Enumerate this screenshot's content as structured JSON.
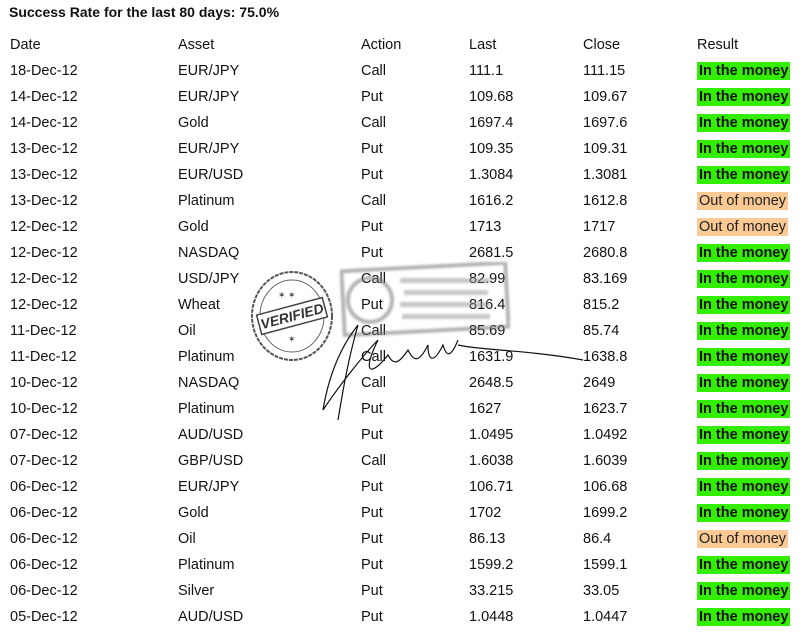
{
  "title": "Success Rate for the last 80 days: 75.0%",
  "colors": {
    "in_the_money": "#33ee00",
    "out_of_money": "#fbc994"
  },
  "table": {
    "headers": [
      "Date",
      "Asset",
      "Action",
      "Last",
      "Close",
      "Result"
    ],
    "rows": [
      {
        "date": "18-Dec-12",
        "asset": "EUR/JPY",
        "action": "Call",
        "last": "111.1",
        "close": "111.15",
        "result": "In the money",
        "status": "in"
      },
      {
        "date": "14-Dec-12",
        "asset": "EUR/JPY",
        "action": "Put",
        "last": "109.68",
        "close": "109.67",
        "result": "In the money",
        "status": "in"
      },
      {
        "date": "14-Dec-12",
        "asset": "Gold",
        "action": "Call",
        "last": "1697.4",
        "close": "1697.6",
        "result": "In the money",
        "status": "in"
      },
      {
        "date": "13-Dec-12",
        "asset": "EUR/JPY",
        "action": "Put",
        "last": "109.35",
        "close": "109.31",
        "result": "In the money",
        "status": "in"
      },
      {
        "date": "13-Dec-12",
        "asset": "EUR/USD",
        "action": "Put",
        "last": "1.3084",
        "close": "1.3081",
        "result": "In the money",
        "status": "in"
      },
      {
        "date": "13-Dec-12",
        "asset": "Platinum",
        "action": "Call",
        "last": "1616.2",
        "close": "1612.8",
        "result": "Out of money",
        "status": "out"
      },
      {
        "date": "12-Dec-12",
        "asset": "Gold",
        "action": "Put",
        "last": "1713",
        "close": "1717",
        "result": "Out of money",
        "status": "out"
      },
      {
        "date": "12-Dec-12",
        "asset": "NASDAQ",
        "action": "Put",
        "last": "2681.5",
        "close": "2680.8",
        "result": "In the money",
        "status": "in"
      },
      {
        "date": "12-Dec-12",
        "asset": "USD/JPY",
        "action": "Call",
        "last": "82.99",
        "close": "83.169",
        "result": "In the money",
        "status": "in"
      },
      {
        "date": "12-Dec-12",
        "asset": "Wheat",
        "action": "Put",
        "last": "816.4",
        "close": "815.2",
        "result": "In the money",
        "status": "in"
      },
      {
        "date": "11-Dec-12",
        "asset": "Oil",
        "action": "Call",
        "last": "85.69",
        "close": "85.74",
        "result": "In the money",
        "status": "in"
      },
      {
        "date": "11-Dec-12",
        "asset": "Platinum",
        "action": "Call",
        "last": "1631.9",
        "close": "1638.8",
        "result": "In the money",
        "status": "in"
      },
      {
        "date": "10-Dec-12",
        "asset": "NASDAQ",
        "action": "Call",
        "last": "2648.5",
        "close": "2649",
        "result": "In the money",
        "status": "in"
      },
      {
        "date": "10-Dec-12",
        "asset": "Platinum",
        "action": "Put",
        "last": "1627",
        "close": "1623.7",
        "result": "In the money",
        "status": "in"
      },
      {
        "date": "07-Dec-12",
        "asset": "AUD/USD",
        "action": "Put",
        "last": "1.0495",
        "close": "1.0492",
        "result": "In the money",
        "status": "in"
      },
      {
        "date": "07-Dec-12",
        "asset": "GBP/USD",
        "action": "Call",
        "last": "1.6038",
        "close": "1.6039",
        "result": "In the money",
        "status": "in"
      },
      {
        "date": "06-Dec-12",
        "asset": "EUR/JPY",
        "action": "Put",
        "last": "106.71",
        "close": "106.68",
        "result": "In the money",
        "status": "in"
      },
      {
        "date": "06-Dec-12",
        "asset": "Gold",
        "action": "Put",
        "last": "1702",
        "close": "1699.2",
        "result": "In the money",
        "status": "in"
      },
      {
        "date": "06-Dec-12",
        "asset": "Oil",
        "action": "Put",
        "last": "86.13",
        "close": "86.4",
        "result": "Out of money",
        "status": "out"
      },
      {
        "date": "06-Dec-12",
        "asset": "Platinum",
        "action": "Put",
        "last": "1599.2",
        "close": "1599.1",
        "result": "In the money",
        "status": "in"
      },
      {
        "date": "06-Dec-12",
        "asset": "Silver",
        "action": "Put",
        "last": "33.215",
        "close": "33.05",
        "result": "In the money",
        "status": "in"
      },
      {
        "date": "05-Dec-12",
        "asset": "AUD/USD",
        "action": "Put",
        "last": "1.0448",
        "close": "1.0447",
        "result": "In the money",
        "status": "in"
      }
    ]
  },
  "stamp": {
    "label": "VERIFIED",
    "ring_text": "VERIFIED"
  }
}
